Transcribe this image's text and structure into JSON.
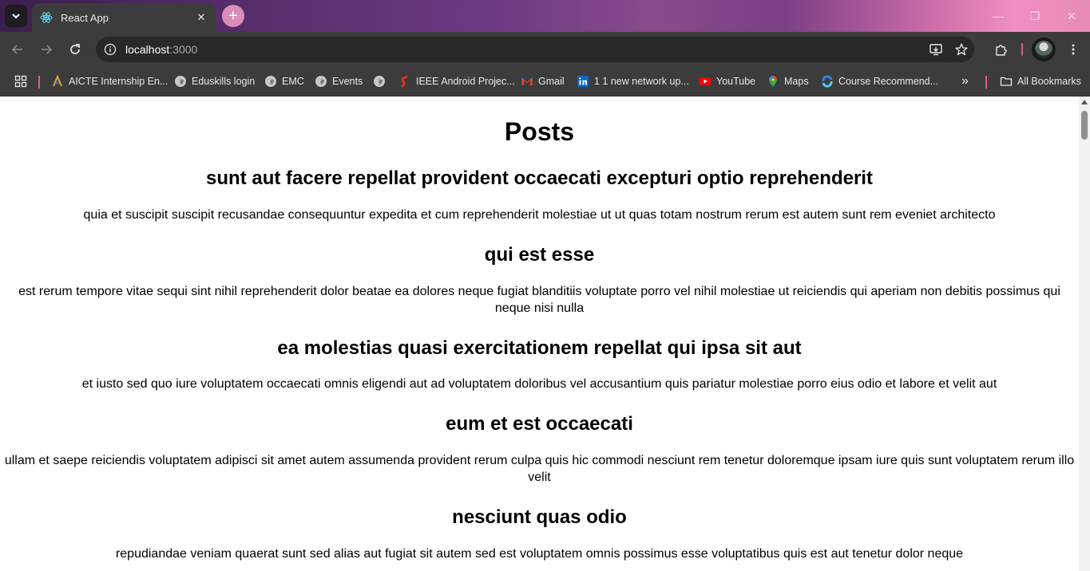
{
  "browser": {
    "tab": {
      "title": "React App",
      "close_glyph": "✕"
    },
    "new_tab_glyph": "+",
    "window_controls": {
      "minimize": "—",
      "restore": "❐",
      "close": "✕"
    },
    "address": {
      "host": "localhost",
      "port": ":3000"
    },
    "bookmarks": [
      {
        "label": "AICTE Internship En...",
        "icon": "aicte-icon"
      },
      {
        "label": "Eduskills login",
        "icon": "globe-icon"
      },
      {
        "label": "EMC",
        "icon": "globe-icon"
      },
      {
        "label": "Events",
        "icon": "globe-icon"
      },
      {
        "label": "",
        "icon": "globe-icon"
      },
      {
        "label": "IEEE Android Projec...",
        "icon": "ieee-icon"
      },
      {
        "label": "Gmail",
        "icon": "gmail-icon"
      },
      {
        "label": "1 1 new network up...",
        "icon": "linkedin-icon"
      },
      {
        "label": "YouTube",
        "icon": "youtube-icon"
      },
      {
        "label": "Maps",
        "icon": "maps-icon"
      },
      {
        "label": "Course Recommend...",
        "icon": "course-icon"
      }
    ],
    "more_bookmarks_glyph": "»",
    "all_bookmarks": "All Bookmarks",
    "colors": {
      "tab_bg": "#3c3c3c",
      "toolbar_bg": "#3c3c3c",
      "omnibox_bg": "#282828",
      "accent": "#e05a8a"
    }
  },
  "page": {
    "heading": "Posts",
    "posts": [
      {
        "title": "sunt aut facere repellat provident occaecati excepturi optio reprehenderit",
        "body": "quia et suscipit suscipit recusandae consequuntur expedita et cum reprehenderit molestiae ut ut quas totam nostrum rerum est autem sunt rem eveniet architecto"
      },
      {
        "title": "qui est esse",
        "body": "est rerum tempore vitae sequi sint nihil reprehenderit dolor beatae ea dolores neque fugiat blanditiis voluptate porro vel nihil molestiae ut reiciendis qui aperiam non debitis possimus qui neque nisi nulla"
      },
      {
        "title": "ea molestias quasi exercitationem repellat qui ipsa sit aut",
        "body": "et iusto sed quo iure voluptatem occaecati omnis eligendi aut ad voluptatem doloribus vel accusantium quis pariatur molestiae porro eius odio et labore et velit aut"
      },
      {
        "title": "eum et est occaecati",
        "body": "ullam et saepe reiciendis voluptatem adipisci sit amet autem assumenda provident rerum culpa quis hic commodi nesciunt rem tenetur doloremque ipsam iure quis sunt voluptatem rerum illo velit"
      },
      {
        "title": "nesciunt quas odio",
        "body": "repudiandae veniam quaerat sunt sed alias aut fugiat sit autem sed est voluptatem omnis possimus esse voluptatibus quis est aut tenetur dolor neque"
      }
    ]
  }
}
